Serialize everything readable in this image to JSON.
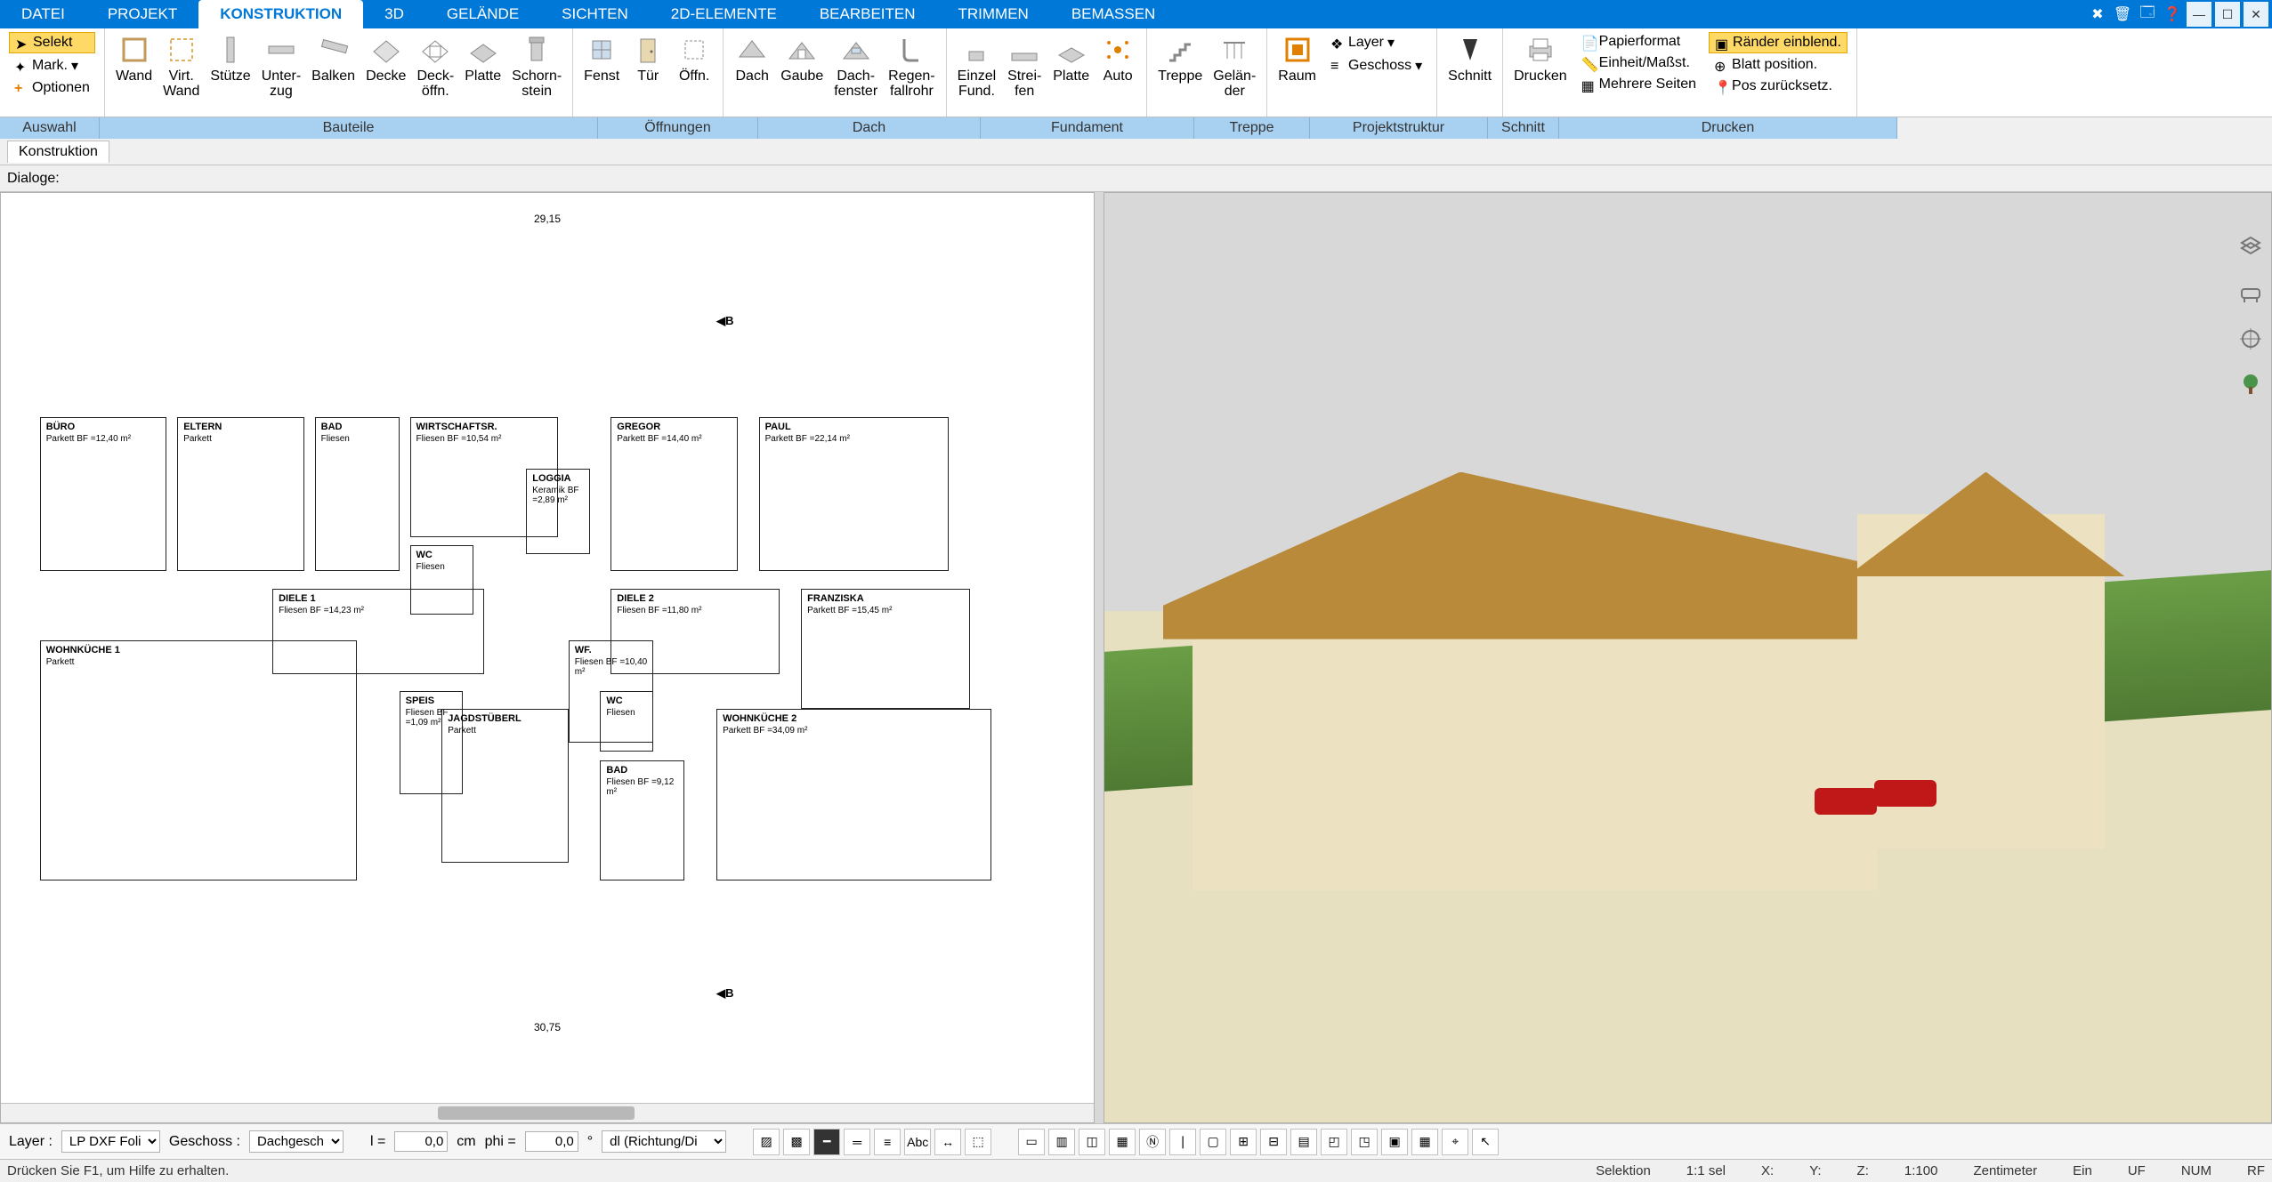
{
  "menu": {
    "tabs": [
      "DATEI",
      "PROJEKT",
      "KONSTRUKTION",
      "3D",
      "GELÄNDE",
      "SICHTEN",
      "2D-ELEMENTE",
      "BEARBEITEN",
      "TRIMMEN",
      "BEMASSEN"
    ],
    "active_index": 2
  },
  "ribbon": {
    "auswahl": {
      "selekt": "Selekt",
      "mark": "Mark.",
      "optionen": "Optionen"
    },
    "bauteile": {
      "wand": "Wand",
      "virt_wand": "Virt.\nWand",
      "stuetze": "Stütze",
      "unterzug": "Unter-\nzug",
      "balken": "Balken",
      "decke": "Decke",
      "deckoeffn": "Deck-\nöffn.",
      "platte": "Platte",
      "schornstein": "Schorn-\nstein"
    },
    "oeffnungen": {
      "fenster": "Fenst",
      "tuer": "Tür",
      "oeffn": "Öffn."
    },
    "dach": {
      "dach": "Dach",
      "gaube": "Gaube",
      "dachfenster": "Dach-\nfenster",
      "fallrohr": "Regen-\nfallrohr"
    },
    "fundament": {
      "einzel": "Einzel\nFund.",
      "streifen": "Strei-\nfen",
      "platte": "Platte",
      "auto": "Auto"
    },
    "treppe": {
      "treppe": "Treppe",
      "gelaender": "Gelän-\nder"
    },
    "projektstruktur": {
      "raum": "Raum",
      "layer": "Layer",
      "geschoss": "Geschoss"
    },
    "schnitt": {
      "schnitt": "Schnitt"
    },
    "drucken": {
      "drucken": "Drucken",
      "papierformat": "Papierformat",
      "einheit": "Einheit/Maßst.",
      "mehrere": "Mehrere Seiten",
      "raender": "Ränder einblend.",
      "blattpos": "Blatt position.",
      "poszurueck": "Pos zurücksetz."
    },
    "group_labels": {
      "auswahl": "Auswahl",
      "bauteile": "Bauteile",
      "oeffnungen": "Öffnungen",
      "dach": "Dach",
      "fundament": "Fundament",
      "treppe": "Treppe",
      "projektstruktur": "Projektstruktur",
      "schnitt": "Schnitt",
      "drucken": "Drucken"
    }
  },
  "subbars": {
    "konstruktion_tab": "Konstruktion",
    "dialoge": "Dialoge:"
  },
  "floorplan": {
    "dim_top": "29,15",
    "dim_bottom": "30,75",
    "section_marker": "B",
    "rooms": [
      {
        "name": "BÜRO",
        "detail": "Parkett\nBF =12,40 m²"
      },
      {
        "name": "ELTERN",
        "detail": "Parkett"
      },
      {
        "name": "BAD",
        "detail": "Fliesen"
      },
      {
        "name": "WIRTSCHAFTSR.",
        "detail": "Fliesen\nBF =10,54 m²"
      },
      {
        "name": "LOGGIA",
        "detail": "Keramik\nBF =2,89 m²"
      },
      {
        "name": "WC",
        "detail": "Fliesen"
      },
      {
        "name": "DIELE 1",
        "detail": "Fliesen\nBF =14,23 m²"
      },
      {
        "name": "SPEIS",
        "detail": "Fliesen\nBF =1,09 m²"
      },
      {
        "name": "JAGDSTÜBERL",
        "detail": "Parkett"
      },
      {
        "name": "WOHNKÜCHE 1",
        "detail": "Parkett"
      },
      {
        "name": "GREGOR",
        "detail": "Parkett\nBF =14,40 m²"
      },
      {
        "name": "PAUL",
        "detail": "Parkett\nBF =22,14 m²"
      },
      {
        "name": "DIELE 2",
        "detail": "Fliesen\nBF =11,80 m²"
      },
      {
        "name": "WF.",
        "detail": "Fliesen\nBF =10,40 m²"
      },
      {
        "name": "BAD",
        "detail": "Fliesen\nBF =9,12 m²"
      },
      {
        "name": "WC",
        "detail": "Fliesen"
      },
      {
        "name": "FRANZISKA",
        "detail": "Parkett\nBF =15,45 m²"
      },
      {
        "name": "WOHNKÜCHE 2",
        "detail": "Parkett\nBF =34,09 m²"
      }
    ]
  },
  "propbar": {
    "layer_label": "Layer :",
    "layer_value": "LP DXF Foli",
    "geschoss_label": "Geschoss :",
    "geschoss_value": "Dachgesch",
    "l_label": "l =",
    "l_value": "0,0",
    "l_unit": "cm",
    "phi_label": "phi =",
    "phi_value": "0,0",
    "phi_unit": "°",
    "mode": "dl (Richtung/Di"
  },
  "status": {
    "help": "Drücken Sie F1, um Hilfe zu erhalten.",
    "selektion": "Selektion",
    "sel": "1:1 sel",
    "x": "X:",
    "y": "Y:",
    "z": "Z:",
    "scale": "1:100",
    "unit": "Zentimeter",
    "ein": "Ein",
    "uf": "UF",
    "num": "NUM",
    "rf": "RF"
  }
}
